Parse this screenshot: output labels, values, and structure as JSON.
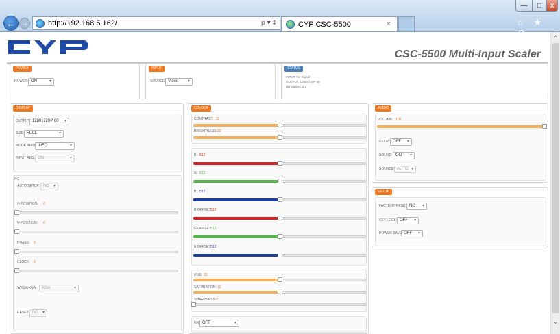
{
  "window": {
    "minimize": "—",
    "maximize": "□",
    "close": "x"
  },
  "browser": {
    "back_glyph": "←",
    "forward_glyph": "→",
    "url": "http://192.168.5.162/",
    "addr_controls": "ρ ▾ ¢",
    "tab_title": "CYP CSC-5500",
    "tab_close": "×",
    "toolbar_icons": "⌂ ★ ⚙"
  },
  "header": {
    "product_title": "CSC-5500 Multi-Input Scaler",
    "logo_color": "#1f4aa8"
  },
  "power": {
    "title": "POWER",
    "power_label": "POWER:",
    "power_value": "ON"
  },
  "input": {
    "title": "INPUT",
    "source_label": "SOURCE:",
    "source_value": "Video"
  },
  "status": {
    "title": "STATUS",
    "input_line": "INPUT: No Signal",
    "output_line": "OUTPUT: 1280x720P 60",
    "revision_line": "REVISION: 2.2"
  },
  "display": {
    "title": "DISPLAY",
    "output_label": "OUTPUT:",
    "output_value": "1280x720P 60",
    "size_label": "SIZE:",
    "size_value": "FULL",
    "mode_info_label": "MODE INFO:",
    "mode_info_value": "INFO",
    "input_res_label": "INPUT RES.:",
    "input_res_value": "ON",
    "pc_label": "PC",
    "auto_setup_label": "AUTO SETUP:",
    "auto_setup_value": "NO",
    "h_position_label": "H-POSITION:",
    "h_position_value": "0",
    "v_position_label": "V-POSITION:",
    "v_position_value": "0",
    "phase_label": "PHASE:",
    "phase_value": "0",
    "clock_label": "CLOCK:",
    "clock_value": "0",
    "wxga_label": "WXGA/XGA:",
    "wxga_value": "XGA",
    "reset_label": "RESET:",
    "reset_value": "NO"
  },
  "colour": {
    "title": "COLOUR",
    "contrast_label": "CONTRAST:",
    "contrast_value": "32",
    "brightness_label": "BRIGHTNESS:",
    "brightness_value": "32",
    "r_label": "R:",
    "r_value": "512",
    "g_label": "G:",
    "g_value": "512",
    "b_label": "B:",
    "b_value": "512",
    "r_offset_label": "R OFFSET:",
    "r_offset_value": "512",
    "g_offset_label": "G OFFSET:",
    "g_offset_value": "512",
    "b_offset_label": "B OFFSET:",
    "b_offset_value": "512",
    "hue_label": "HUE:",
    "hue_value": "32",
    "saturation_label": "SATURATION:",
    "saturation_value": "32",
    "sharpness_label": "SHARPNESS:",
    "sharpness_value": "0",
    "nr_label": "NR:",
    "nr_value": "OFF",
    "level_contrast": 0.5,
    "level_brightness": 0.5,
    "level_r": 0.5,
    "level_g": 0.5,
    "level_b": 0.5,
    "level_r_offset": 0.5,
    "level_g_offset": 0.5,
    "level_b_offset": 0.5,
    "level_hue": 0.5,
    "level_saturation": 0.5,
    "level_sharpness": 0,
    "colors": {
      "accent": "#f07820",
      "bar": "#f2b25f",
      "red": "#e02020",
      "green": "#54b848",
      "blue": "#1a3f9c"
    }
  },
  "audio": {
    "title": "AUDIO",
    "volume_label": "VOLUME:",
    "volume_value": "100",
    "level_volume": 1.0,
    "delay_label": "DELAY:",
    "delay_value": "OFF",
    "sound_label": "SOUND:",
    "sound_value": "ON",
    "source_label": "SOURCE:",
    "source_value": "AUTO"
  },
  "setup": {
    "title": "SETUP",
    "factory_reset_label": "FACTORY RESET:",
    "factory_reset_value": "NO",
    "key_lock_label": "KEY LOCK:",
    "key_lock_value": "OFF",
    "power_save_label": "POWER SAVE:",
    "power_save_value": "OFF"
  }
}
